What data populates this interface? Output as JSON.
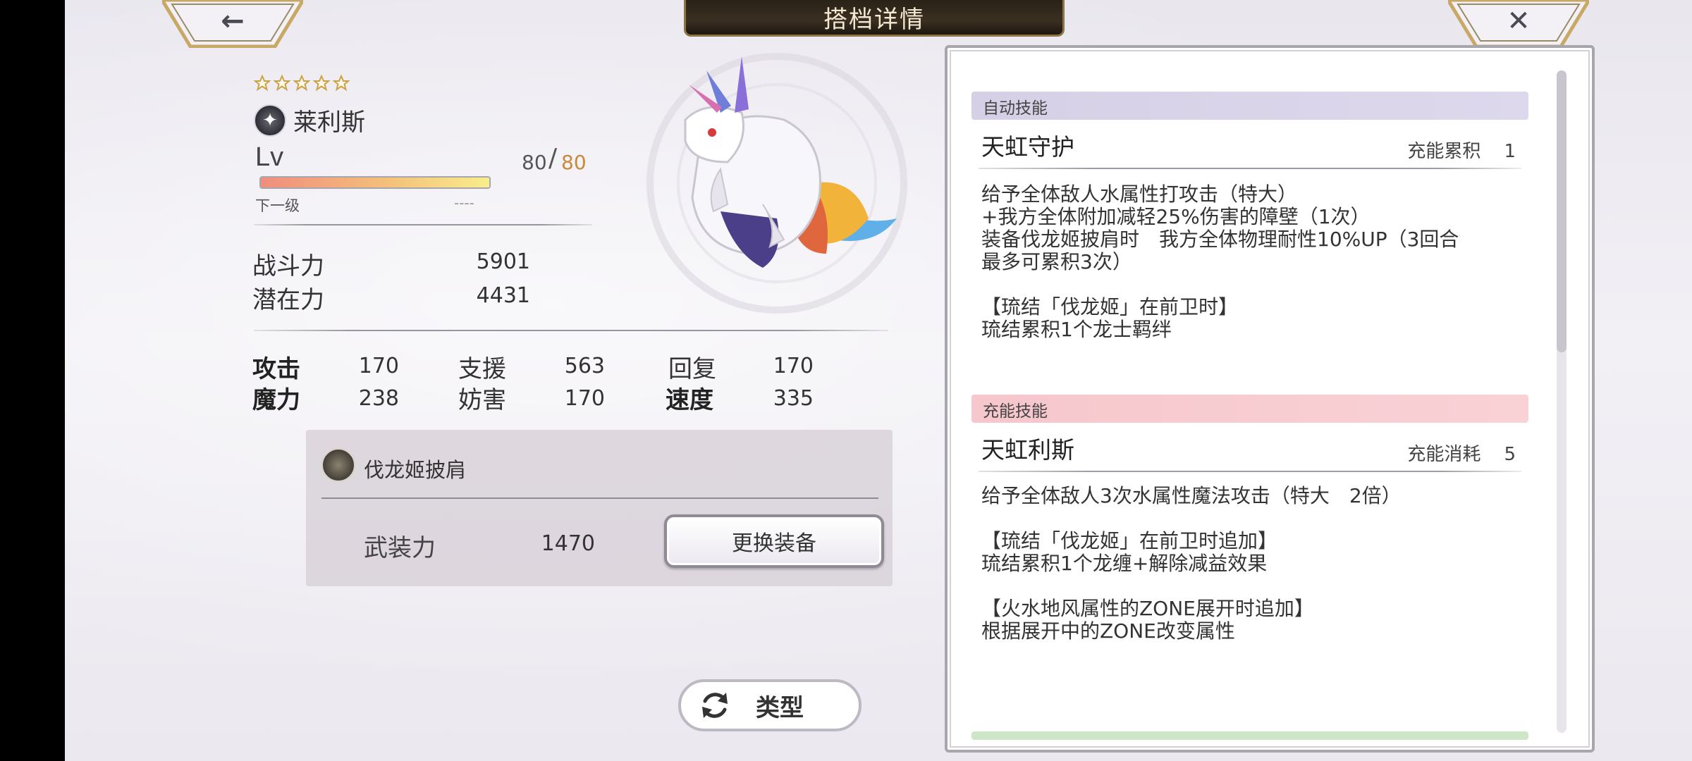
{
  "header": {
    "title": "搭档详情"
  },
  "nav": {
    "back_glyph": "←",
    "close_glyph": "✕"
  },
  "character": {
    "rarity_stars": 5,
    "element_icon": "gear-star-emblem-icon",
    "name": "莱利斯",
    "level_label": "Lv",
    "level_current": "80",
    "level_max": "80",
    "level_progress": 1.0,
    "next_level_label": "下一级",
    "next_level_value": "----",
    "combat_power_label": "战斗力",
    "combat_power": "5901",
    "potential_label": "潜在力",
    "potential": "4431"
  },
  "attributes": {
    "attack_label": "攻击",
    "attack": "170",
    "support_label": "支援",
    "support": "563",
    "recover_label": "回复",
    "recover": "170",
    "magic_label": "魔力",
    "magic": "238",
    "hinder_label": "妨害",
    "hinder": "170",
    "speed_label": "速度",
    "speed": "335"
  },
  "equipment": {
    "name": "伐龙姬披肩",
    "armor_label": "武装力",
    "armor_value": "1470",
    "change_button": "更换装备"
  },
  "type_button": {
    "label": "类型",
    "icon": "refresh-icon"
  },
  "skills": {
    "auto": {
      "header": "自动技能",
      "name": "天虹守护",
      "meta_label": "充能累积",
      "meta_value": "1",
      "desc": [
        "给予全体敌人水属性打攻击（特大）",
        "+我方全体附加减轻25%伤害的障壁（1次）",
        "装备伐龙姬披肩时　我方全体物理耐性10%UP（3回合",
        "最多可累积3次）",
        "",
        "【琉结「伐龙姬」在前卫时】",
        "琉结累积1个龙士羁绊"
      ]
    },
    "charge": {
      "header": "充能技能",
      "name": "天虹利斯",
      "meta_label": "充能消耗",
      "meta_value": "5",
      "desc": [
        "给予全体敌人3次水属性魔法攻击（特大　2倍）",
        "",
        "【琉结「伐龙姬」在前卫时追加】",
        "琉结累积1个龙缠+解除减益效果",
        "",
        "【火水地风属性的ZONE展开时追加】",
        "根据展开中的ZONE改变属性"
      ]
    }
  }
}
